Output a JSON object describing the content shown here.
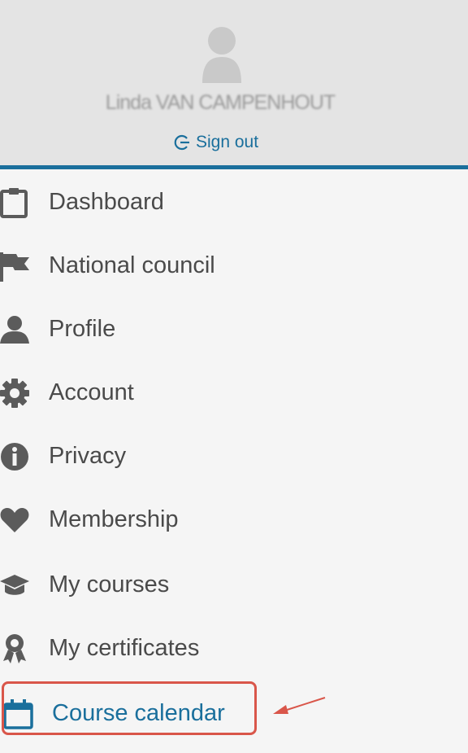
{
  "user": {
    "name": "Linda VAN CAMPENHOUT",
    "signout_label": "Sign out"
  },
  "menu": {
    "items": [
      {
        "label": "Dashboard",
        "icon": "clipboard-icon"
      },
      {
        "label": "National council",
        "icon": "flag-icon"
      },
      {
        "label": "Profile",
        "icon": "person-icon"
      },
      {
        "label": "Account",
        "icon": "gear-icon"
      },
      {
        "label": "Privacy",
        "icon": "info-icon"
      },
      {
        "label": "Membership",
        "icon": "heart-icon"
      },
      {
        "label": "My courses",
        "icon": "graduation-cap-icon"
      },
      {
        "label": "My certificates",
        "icon": "award-icon"
      },
      {
        "label": "Course calendar",
        "icon": "calendar-icon",
        "active": true
      }
    ]
  },
  "colors": {
    "accent": "#1a6f9c",
    "header_bg": "#e4e4e4",
    "page_bg": "#f5f5f5",
    "icon": "#5b5b5b",
    "highlight": "#d9564a"
  }
}
